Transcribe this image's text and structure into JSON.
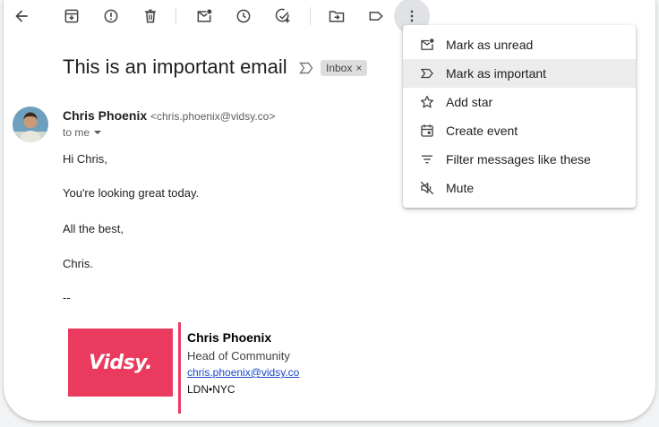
{
  "toolbar": {
    "icons": [
      "back-arrow-icon",
      "archive-icon",
      "report-spam-icon",
      "delete-icon",
      "mark-unread-icon",
      "snooze-icon",
      "add-to-tasks-icon",
      "move-to-icon",
      "label-icon",
      "more-options-icon"
    ]
  },
  "email": {
    "subject": "This is an important email",
    "label_chip": "Inbox",
    "label_chip_close": "×",
    "sender_name": "Chris Phoenix",
    "sender_email": "<chris.phoenix@vidsy.co>",
    "recipient": "to me",
    "body": [
      "Hi Chris,",
      "You're looking great today.",
      "All the best,",
      "Chris.",
      "--"
    ]
  },
  "signature": {
    "logo_text": "Vidsy.",
    "name": "Chris Phoenix",
    "title": "Head of Community",
    "email": "chris.phoenix@vidsy.co",
    "location": "LDN•NYC"
  },
  "menu": {
    "items": [
      {
        "label": "Mark as unread",
        "icon": "mark-unread-icon"
      },
      {
        "label": "Mark as important",
        "icon": "important-icon"
      },
      {
        "label": "Add star",
        "icon": "star-icon"
      },
      {
        "label": "Create event",
        "icon": "calendar-icon"
      },
      {
        "label": "Filter messages like these",
        "icon": "filter-icon"
      },
      {
        "label": "Mute",
        "icon": "mute-icon"
      }
    ]
  },
  "colors": {
    "brand": "#ea3a5e",
    "link": "#1a47c8",
    "menu_hover": "#ececec"
  }
}
